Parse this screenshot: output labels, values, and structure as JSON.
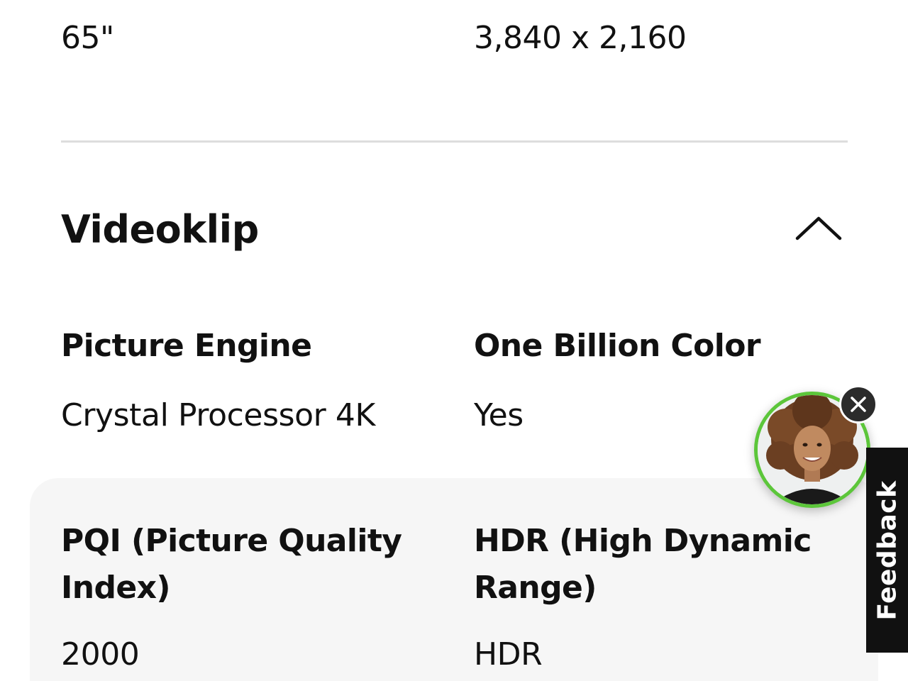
{
  "top_row": {
    "left_value": "65\"",
    "right_value": "3,840 x 2,160"
  },
  "section": {
    "title": "Videoklip",
    "toggle_icon": "chevron-up-icon",
    "state": "expanded"
  },
  "specs": [
    {
      "label": "Picture Engine",
      "value": "Crystal Processor 4K"
    },
    {
      "label": "One Billion Color",
      "value": "Yes"
    },
    {
      "label": "PQI (Picture Quality Index)",
      "value": "2000"
    },
    {
      "label": "HDR (High Dynamic Range)",
      "value": "HDR"
    }
  ],
  "chat_widget": {
    "avatar_icon": "agent-avatar",
    "close_icon": "close-icon",
    "ring_color": "#5cc63a"
  },
  "feedback": {
    "label": "Feedback"
  },
  "colors": {
    "divider": "#dddddd",
    "panel_background": "#f6f6f6",
    "text": "#111111"
  }
}
